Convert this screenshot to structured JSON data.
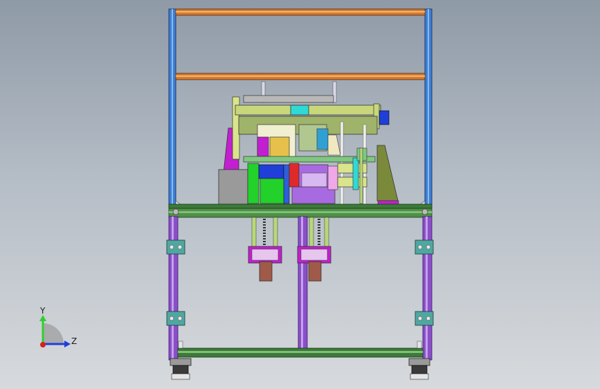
{
  "viewport": {
    "background_top": "#8f9aa7",
    "background_bottom": "#d7dadd"
  },
  "triad": {
    "y_label": "Y",
    "z_label": "Z",
    "y_color": "#2fcf2f",
    "z_color": "#1f3fd8",
    "x_color": "#d81f1f"
  },
  "colors": {
    "frame_blue": "#3c7fd4",
    "beam_orange": "#d67b2e",
    "frame_purple": "#8a4fc8",
    "frame_green": "#3d7a3a",
    "bright_green": "#22d12a",
    "magenta": "#c21fd0",
    "cyan": "#2fd9d4",
    "olive": "#7a8a3a",
    "gray_block": "#9a9a9a",
    "red_block": "#e02a2a",
    "brown_block": "#a05a4a"
  }
}
